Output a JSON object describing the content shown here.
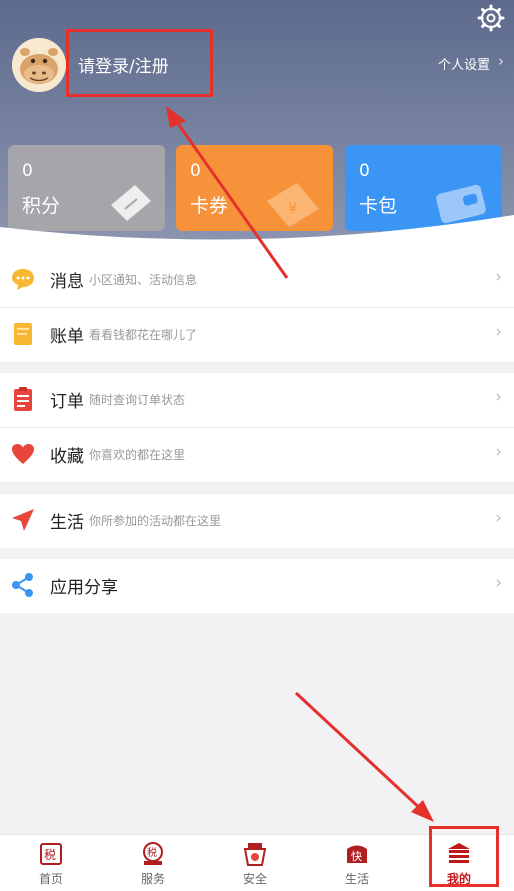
{
  "header": {
    "login_label": "请登录/注册",
    "settings_label": "个人设置",
    "settings_chevron": "›"
  },
  "cards": [
    {
      "value": "0",
      "label": "积分",
      "color": "#a6a6aa"
    },
    {
      "value": "0",
      "label": "卡券",
      "color": "#f6923a"
    },
    {
      "value": "0",
      "label": "卡包",
      "color": "#3a95f5"
    }
  ],
  "menu": [
    {
      "title": "消息",
      "subtitle": "小区通知、活动信息",
      "icon": "chat-bubble-icon",
      "color": "#f7b733"
    },
    {
      "title": "账单",
      "subtitle": "看看钱都花在哪儿了",
      "icon": "bill-icon",
      "color": "#f7b733"
    },
    {
      "title": "订单",
      "subtitle": "随时查询订单状态",
      "icon": "clipboard-icon",
      "color": "#e8453c"
    },
    {
      "title": "收藏",
      "subtitle": "你喜欢的都在这里",
      "icon": "heart-icon",
      "color": "#e8453c"
    },
    {
      "title": "生活",
      "subtitle": "你所参加的活动都在这里",
      "icon": "paper-plane-icon",
      "color": "#e8453c"
    },
    {
      "title": "应用分享",
      "subtitle": "",
      "icon": "share-icon",
      "color": "#3a95f5"
    }
  ],
  "chevron": "›",
  "tabs": [
    {
      "label": "首页",
      "icon": "home-icon"
    },
    {
      "label": "服务",
      "icon": "service-icon"
    },
    {
      "label": "安全",
      "icon": "safety-icon"
    },
    {
      "label": "生活",
      "icon": "life-icon"
    },
    {
      "label": "我的",
      "icon": "profile-icon",
      "active": true
    }
  ],
  "tab_icon_glyphs": {
    "home": "税",
    "service": "税",
    "life": "快"
  },
  "accent_color": "#c01818",
  "annotation_color": "#e5302c"
}
